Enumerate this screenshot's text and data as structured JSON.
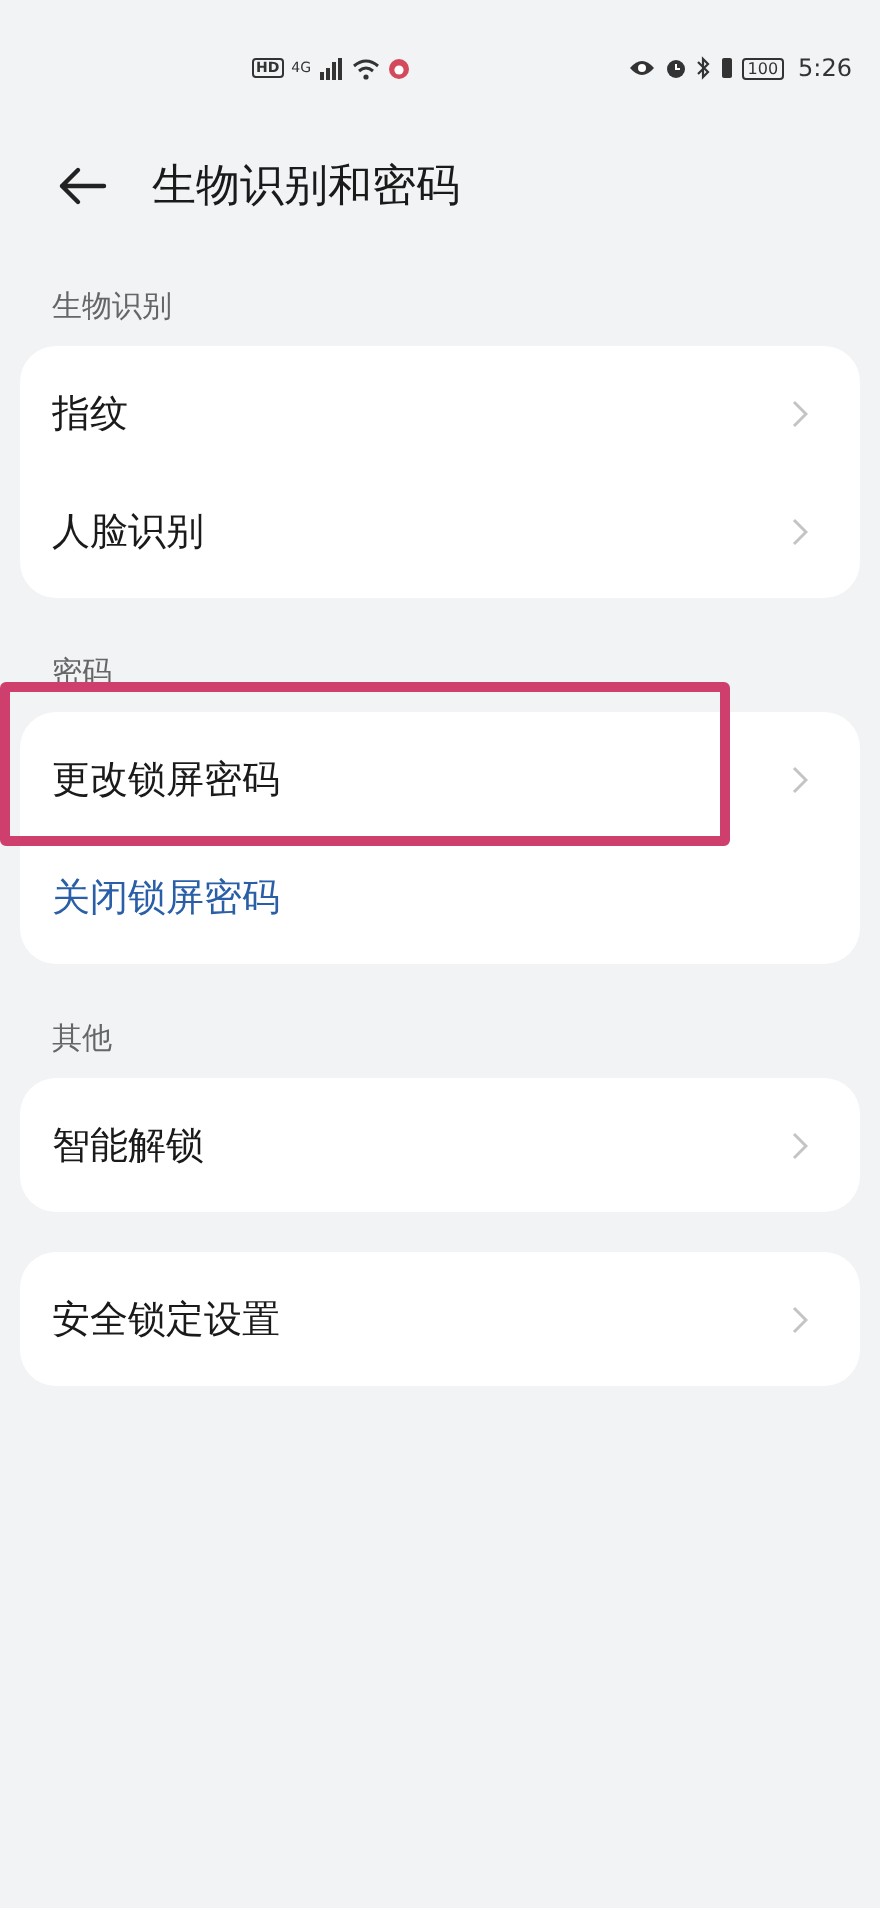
{
  "status_bar": {
    "hd": "HD",
    "network": "4G",
    "battery": "100",
    "time": "5:26"
  },
  "header": {
    "title": "生物识别和密码"
  },
  "sections": [
    {
      "label": "生物识别",
      "groups": [
        [
          {
            "label": "指纹",
            "kind": "nav",
            "highlighted": false
          },
          {
            "label": "人脸识别",
            "kind": "nav",
            "highlighted": false
          }
        ]
      ]
    },
    {
      "label": "密码",
      "groups": [
        [
          {
            "label": "更改锁屏密码",
            "kind": "nav",
            "highlighted": true
          },
          {
            "label": "关闭锁屏密码",
            "kind": "link",
            "highlighted": false
          }
        ]
      ]
    },
    {
      "label": "其他",
      "groups": [
        [
          {
            "label": "智能解锁",
            "kind": "nav",
            "highlighted": false
          }
        ],
        [
          {
            "label": "安全锁定设置",
            "kind": "nav",
            "highlighted": false
          }
        ]
      ]
    }
  ]
}
